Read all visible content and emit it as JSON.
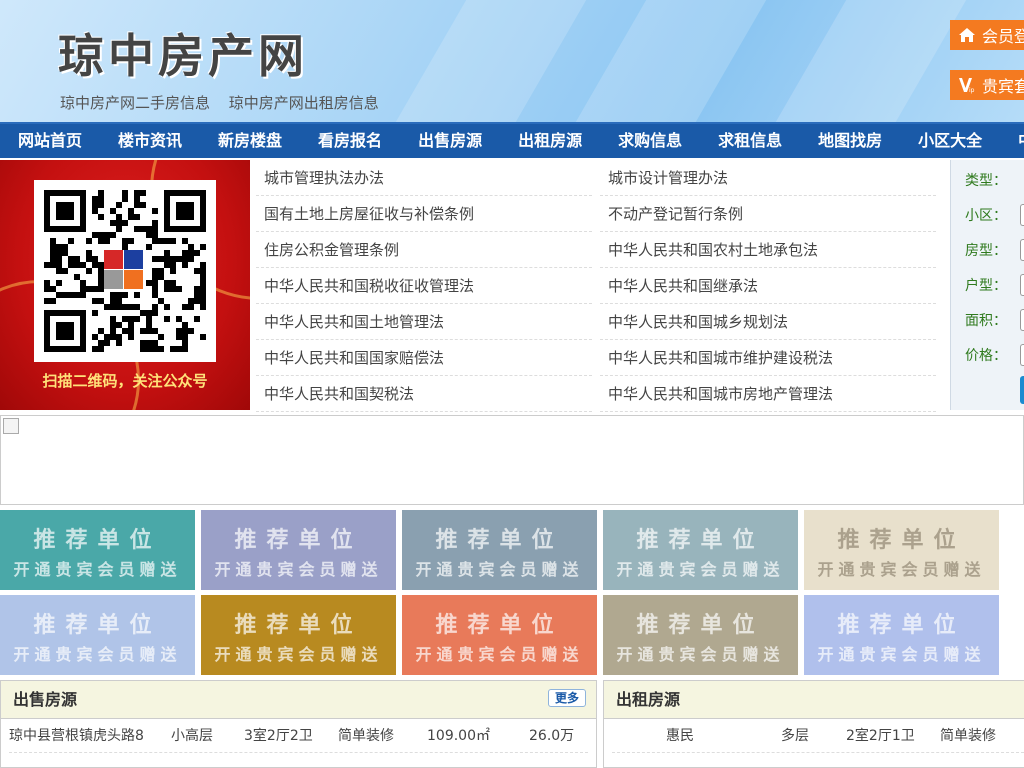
{
  "header": {
    "site_title": "琼中房产网",
    "links": [
      "琼中房产网二手房信息",
      "琼中房产网出租房信息"
    ],
    "member_login": "会员登",
    "vip": "贵宾套"
  },
  "nav": [
    "网站首页",
    "楼市资讯",
    "新房楼盘",
    "看房报名",
    "出售房源",
    "出租房源",
    "求购信息",
    "求租信息",
    "地图找房",
    "小区大全",
    "中"
  ],
  "qr": {
    "caption": "扫描二维码，关注公众号"
  },
  "laws": {
    "left": [
      "城市管理执法办法",
      "国有土地上房屋征收与补偿条例",
      "住房公积金管理条例",
      "中华人民共和国税收征收管理法",
      "中华人民共和国土地管理法",
      "中华人民共和国国家赔偿法",
      "中华人民共和国契税法"
    ],
    "right": [
      "城市设计管理办法",
      "不动产登记暂行条例",
      "中华人民共和国农村土地承包法",
      "中华人民共和国继承法",
      "中华人民共和国城乡规划法",
      "中华人民共和国城市维护建设税法",
      "中华人民共和国城市房地产管理法"
    ]
  },
  "search": {
    "labels": [
      "类型：",
      "小区：",
      "房型：",
      "户型：",
      "面积：",
      "价格："
    ]
  },
  "tiles": {
    "line1": "推荐单位",
    "line2": "开通贵宾会员赠送",
    "colors": [
      "#4aa8a8",
      "#9aa0c8",
      "#8aa0b0",
      "#98b4bc",
      "#e8e0cc",
      "#b0c4e8",
      "#b88a20",
      "#e87a5a",
      "#b0a890",
      "#b0c0ec"
    ]
  },
  "sale": {
    "title": "出售房源",
    "more": "更多",
    "rows": [
      [
        "琼中县营根镇虎头路8",
        "小高层",
        "3室2厅2卫",
        "简单装修",
        "109.00㎡",
        "26.0万"
      ]
    ]
  },
  "rent": {
    "title": "出租房源",
    "rows": [
      [
        "惠民",
        "多层",
        "2室2厅1卫",
        "简单装修"
      ]
    ]
  }
}
